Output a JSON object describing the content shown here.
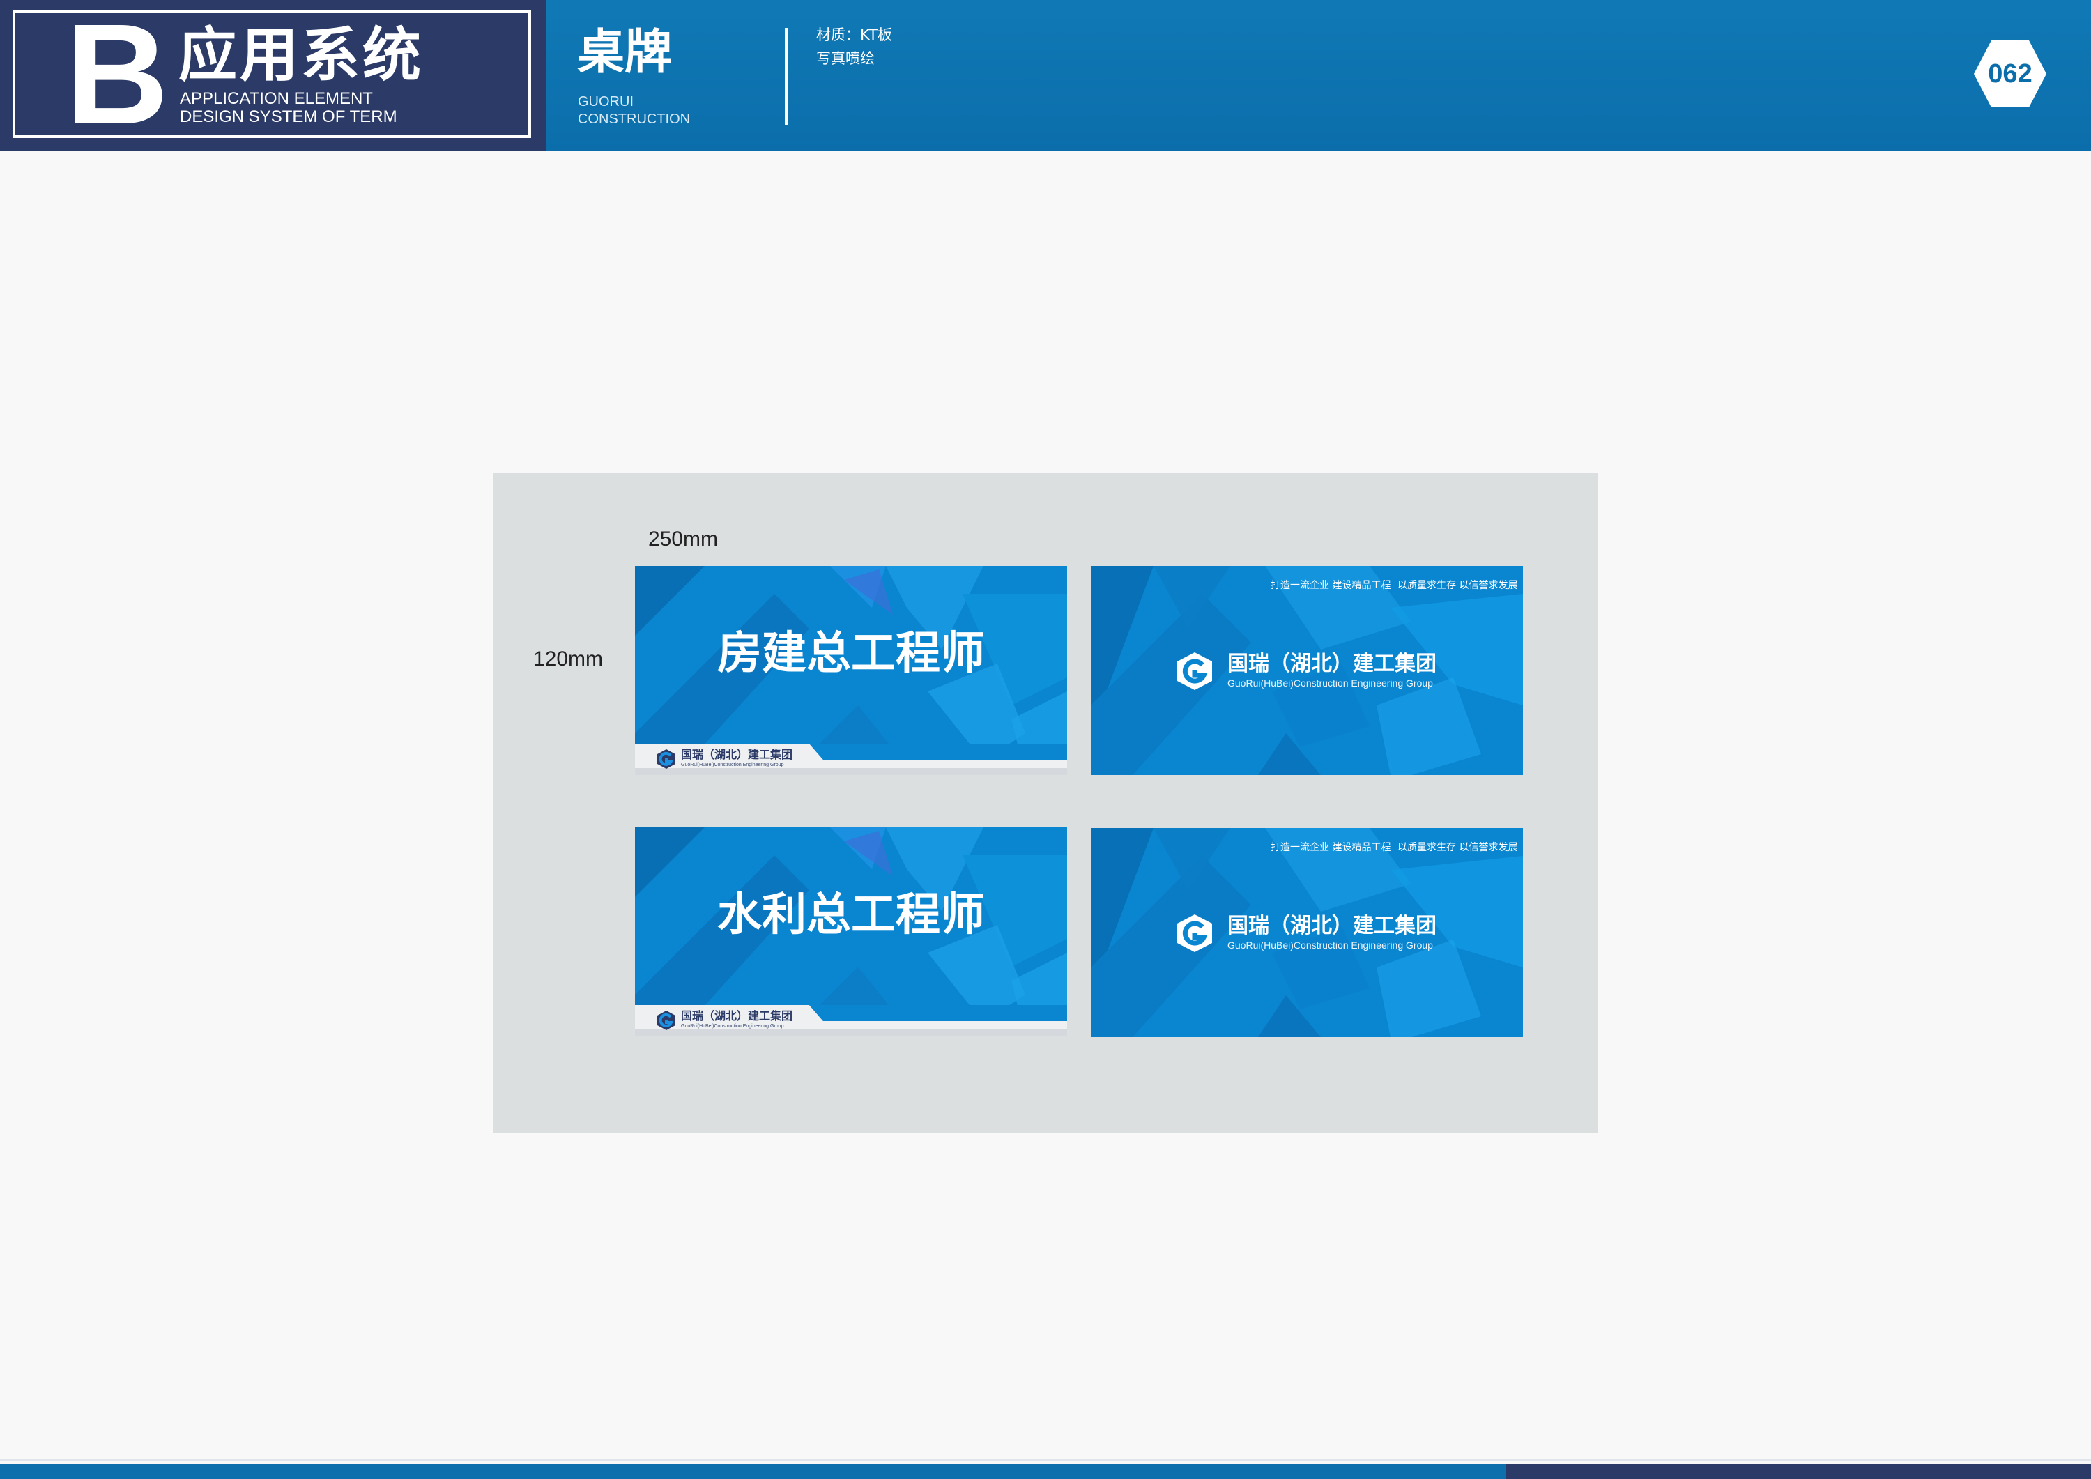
{
  "header": {
    "letter": "B",
    "title_cn": "应用系统",
    "title_en_1": "APPLICATION ELEMENT",
    "title_en_2": "DESIGN SYSTEM OF TERM",
    "section_cn": "桌牌",
    "section_en_1": "GUORUI",
    "section_en_2": "CONSTRUCTION",
    "spec_line_1": "材质：KT板",
    "spec_line_2": "写真喷绘",
    "page_number": "062"
  },
  "dimensions": {
    "width": "250mm",
    "height": "120mm"
  },
  "cards": {
    "front_1": {
      "title": "房建总工程师"
    },
    "front_2": {
      "title": "水利总工程师"
    },
    "logo": {
      "name_cn": "国瑞（湖北）建工集团",
      "name_en": "GuoRui(HuBei)Construction Engineering Group"
    },
    "slogans": {
      "slogan_1": "打造一流企业  建设精品工程",
      "slogan_2": "以质量求生存  以信誉求发展"
    }
  },
  "colors": {
    "header_blue": "#0b6eab",
    "navy": "#2b3a66",
    "card_blue": "#0a86d1",
    "board_gray": "#dcdfe0"
  }
}
